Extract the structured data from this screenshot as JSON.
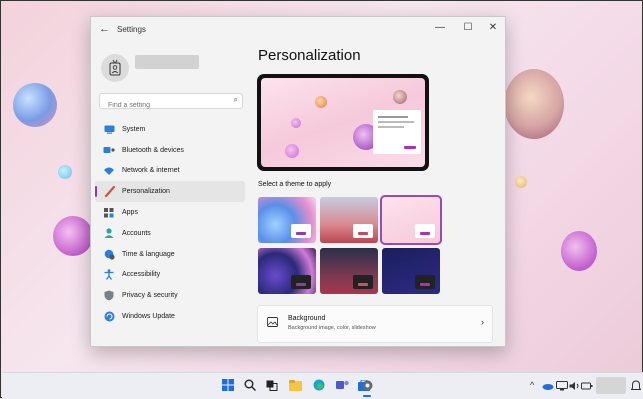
{
  "window": {
    "title": "Settings",
    "back_glyph": "←",
    "minimize_glyph": "—",
    "maximize_glyph": "☐",
    "close_glyph": "✕"
  },
  "search": {
    "placeholder": "Find a setting"
  },
  "sidebar": {
    "items": [
      {
        "label": "System",
        "icon": "display-icon"
      },
      {
        "label": "Bluetooth & devices",
        "icon": "bluetooth-icon"
      },
      {
        "label": "Network & internet",
        "icon": "wifi-icon"
      },
      {
        "label": "Personalization",
        "icon": "brush-icon",
        "active": true
      },
      {
        "label": "Apps",
        "icon": "apps-icon"
      },
      {
        "label": "Accounts",
        "icon": "person-icon"
      },
      {
        "label": "Time & language",
        "icon": "globe-clock-icon"
      },
      {
        "label": "Accessibility",
        "icon": "accessibility-icon"
      },
      {
        "label": "Privacy & security",
        "icon": "shield-icon"
      },
      {
        "label": "Windows Update",
        "icon": "update-icon"
      }
    ]
  },
  "main": {
    "title": "Personalization",
    "themes_label": "Select a theme to apply",
    "themes": [
      {
        "name": "theme-bloom-light",
        "accent": "#8f3ba6",
        "selected": false
      },
      {
        "name": "theme-glow-light",
        "accent": "#c94a5e",
        "selected": false
      },
      {
        "name": "theme-space-light",
        "accent": "#b02eb8",
        "selected": true
      },
      {
        "name": "theme-bloom-dark",
        "accent": "#8f3ba6",
        "selected": false
      },
      {
        "name": "theme-glow-dark",
        "accent": "#d0506a",
        "selected": false
      },
      {
        "name": "theme-space-dark",
        "accent": "#b02eb8",
        "selected": false
      }
    ],
    "background_row": {
      "title": "Background",
      "subtitle": "Background image, color, slideshow",
      "chevron": "›"
    }
  },
  "taskbar": {
    "icons": [
      "windows-start-icon",
      "search-icon",
      "task-view-icon",
      "file-explorer-icon",
      "edge-icon",
      "teams-icon",
      "store-icon",
      "settings-icon"
    ],
    "tray_chevron": "^"
  },
  "colors": {
    "accent": "#8f3ba6",
    "window_bg": "#f3f3f3",
    "taskbar_bg": "#eceef3"
  }
}
